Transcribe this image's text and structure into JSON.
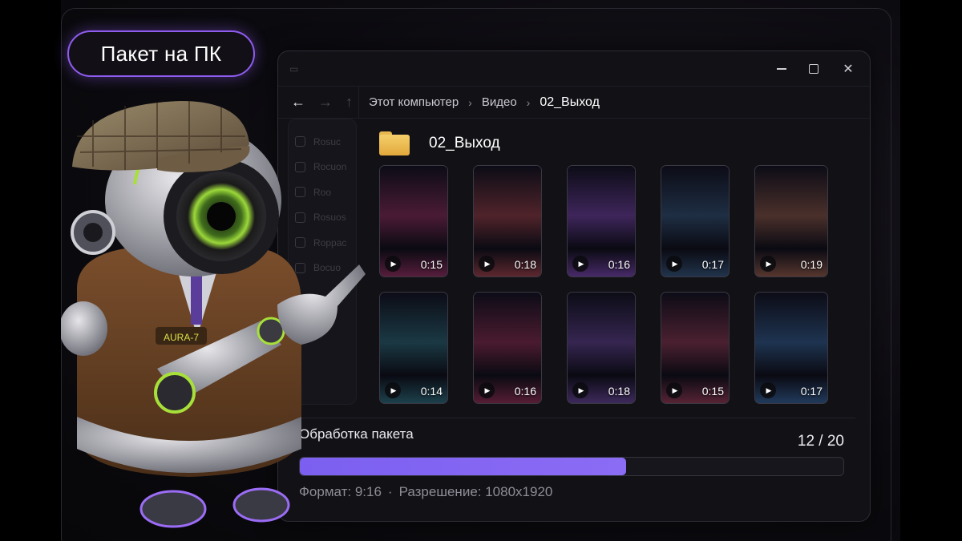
{
  "badge": {
    "label": "Пакет на ПК"
  },
  "window": {
    "controls": [
      "minimize",
      "maximize",
      "close"
    ],
    "nav": {
      "back_icon": "arrow-left-icon",
      "forward_icon": "arrow-right-icon",
      "up_icon": "arrow-up-icon"
    },
    "breadcrumb": [
      "Этот компьютер",
      "Видео",
      "02_Выход"
    ],
    "sidebar": [
      {
        "icon": "download-icon",
        "label": "Rosuc"
      },
      {
        "icon": "doc-icon",
        "label": "Rocuon"
      },
      {
        "icon": "image-icon",
        "label": "Roo"
      },
      {
        "icon": "music-icon",
        "label": "Rosuos"
      },
      {
        "icon": "video-icon",
        "label": "Roppac"
      },
      {
        "icon": "folder-icon",
        "label": "Bocuo"
      }
    ],
    "folder": {
      "title": "02_Выход"
    },
    "videos": [
      {
        "duration": "0:15",
        "hue": "#c03070"
      },
      {
        "duration": "0:18",
        "hue": "#d04a50"
      },
      {
        "duration": "0:16",
        "hue": "#9a50e0"
      },
      {
        "duration": "0:17",
        "hue": "#3a6a9a"
      },
      {
        "duration": "0:19",
        "hue": "#c07050"
      },
      {
        "duration": "0:14",
        "hue": "#2f8a9a"
      },
      {
        "duration": "0:16",
        "hue": "#c03060"
      },
      {
        "duration": "0:18",
        "hue": "#8050c0"
      },
      {
        "duration": "0:15",
        "hue": "#c04060"
      },
      {
        "duration": "0:17",
        "hue": "#3a7ac0"
      }
    ],
    "progress": {
      "label": "Обработка пакета",
      "count": "12 / 20",
      "fraction": 0.6
    },
    "meta": {
      "format": "Формат: 9:16",
      "dot": "·",
      "resolution": "Разрешение: 1080x1920"
    }
  },
  "robot": {
    "chest_label": "AURA-7"
  },
  "colors": {
    "accent": "#8b6cf5",
    "folder": "#f0c45c",
    "background": "#0c0b10"
  }
}
